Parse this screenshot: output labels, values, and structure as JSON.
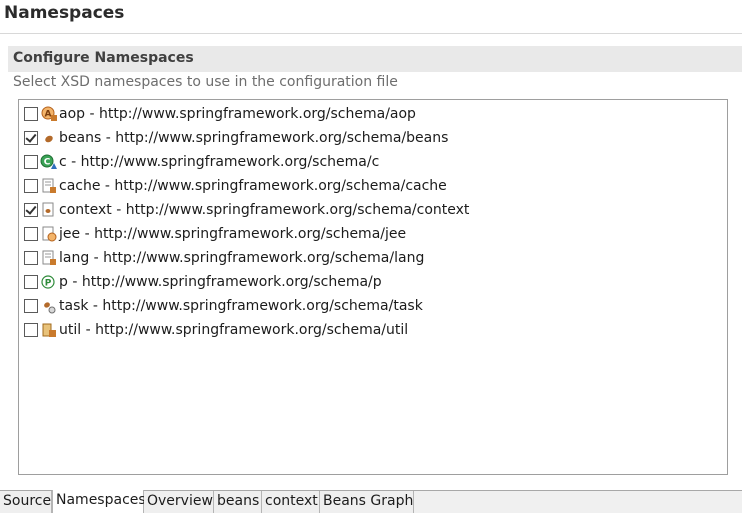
{
  "page": {
    "title": "Namespaces"
  },
  "section": {
    "title": "Configure Namespaces",
    "description": "Select XSD namespaces to use in the configuration file"
  },
  "namespaces": [
    {
      "label": "aop - http://www.springframework.org/schema/aop",
      "checked": false,
      "icon": "aop-namespace-icon"
    },
    {
      "label": "beans - http://www.springframework.org/schema/beans",
      "checked": true,
      "icon": "bean-namespace-icon"
    },
    {
      "label": "c - http://www.springframework.org/schema/c",
      "checked": false,
      "icon": "c-namespace-icon"
    },
    {
      "label": "cache - http://www.springframework.org/schema/cache",
      "checked": false,
      "icon": "cache-namespace-icon"
    },
    {
      "label": "context - http://www.springframework.org/schema/context",
      "checked": true,
      "icon": "context-namespace-icon"
    },
    {
      "label": "jee - http://www.springframework.org/schema/jee",
      "checked": false,
      "icon": "jee-namespace-icon"
    },
    {
      "label": "lang - http://www.springframework.org/schema/lang",
      "checked": false,
      "icon": "lang-namespace-icon"
    },
    {
      "label": "p - http://www.springframework.org/schema/p",
      "checked": false,
      "icon": "p-namespace-icon"
    },
    {
      "label": "task - http://www.springframework.org/schema/task",
      "checked": false,
      "icon": "task-namespace-icon"
    },
    {
      "label": "util - http://www.springframework.org/schema/util",
      "checked": false,
      "icon": "util-namespace-icon"
    }
  ],
  "tabs": [
    {
      "label": "Source",
      "active": false
    },
    {
      "label": "Namespaces",
      "active": true
    },
    {
      "label": "Overview",
      "active": false
    },
    {
      "label": "beans",
      "active": false
    },
    {
      "label": "context",
      "active": false
    },
    {
      "label": "Beans Graph",
      "active": false
    }
  ],
  "colors": {
    "header_bg": "#e9e9e9",
    "icon_orange": "#c8782d",
    "icon_green": "#2e8b3a"
  }
}
